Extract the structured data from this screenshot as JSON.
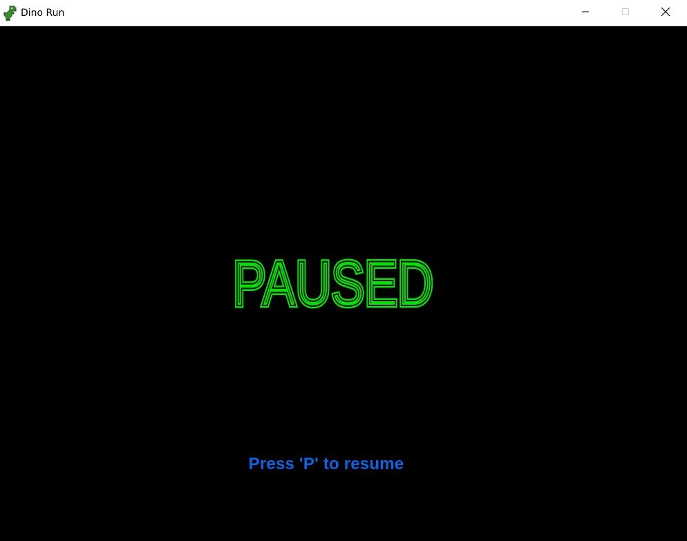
{
  "window": {
    "title": "Dino Run",
    "icon": "dino-icon",
    "controls": {
      "minimize": "minimize-icon",
      "maximize": "maximize-icon",
      "close": "close-icon"
    }
  },
  "game": {
    "status_text": "PAUSED",
    "hint_text": "Press 'P' to resume",
    "colors": {
      "background": "#000000",
      "status": "#00e600",
      "hint": "#0f64e6"
    }
  }
}
